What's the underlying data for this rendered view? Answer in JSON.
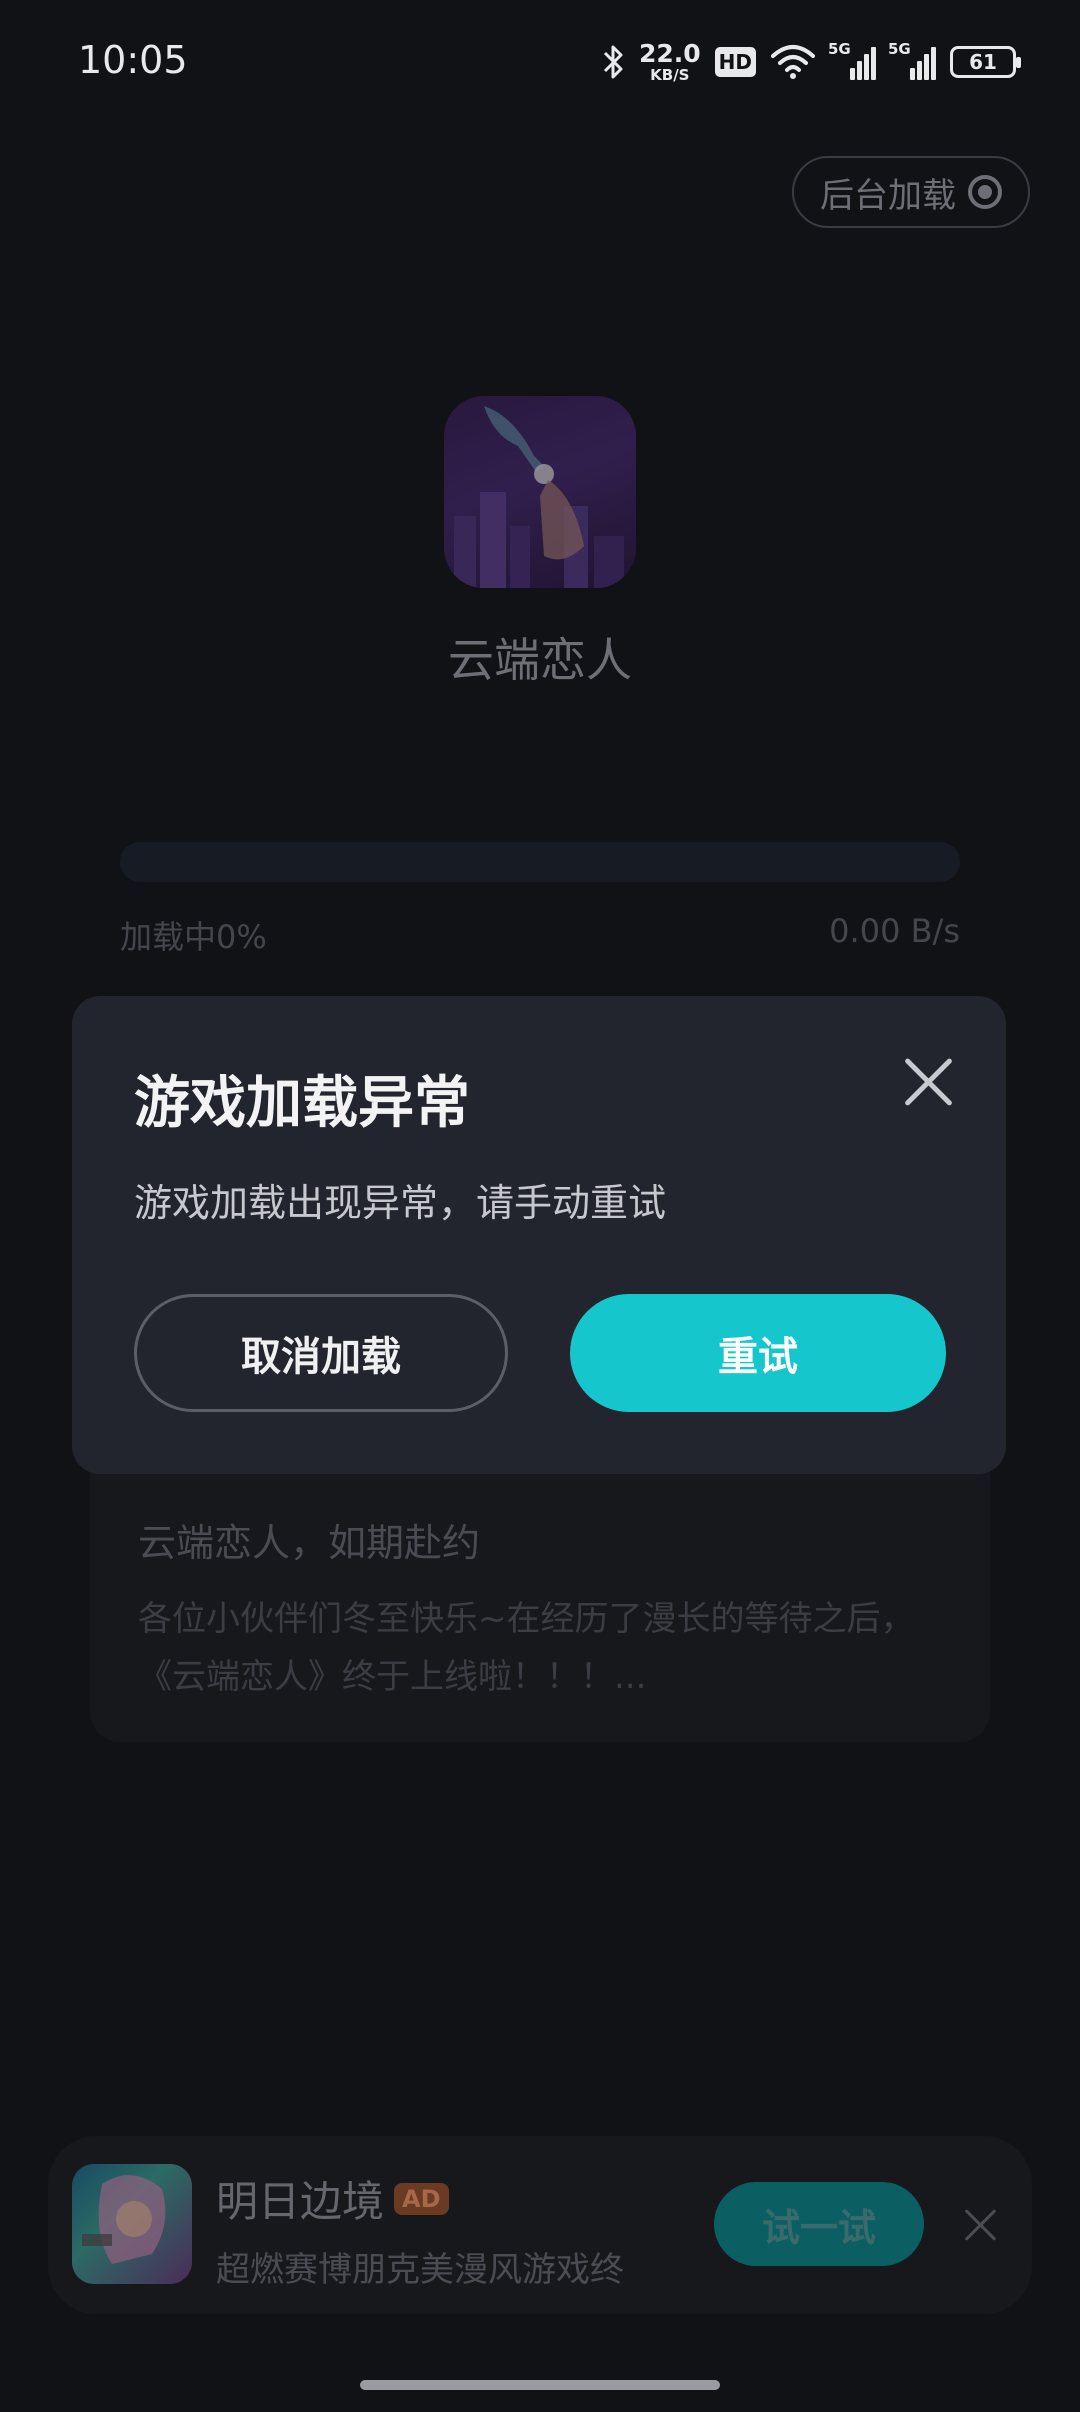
{
  "status_bar": {
    "time": "10:05",
    "net_speed_value": "22.0",
    "net_speed_unit": "KB/S",
    "hd_label": "HD",
    "signal_1_label": "5G",
    "signal_2_label": "5G",
    "battery_level": "61"
  },
  "header": {
    "background_load_label": "后台加载"
  },
  "app": {
    "name": "云端恋人"
  },
  "progress": {
    "label": "加载中0%",
    "percent": 0,
    "speed": "0.00 B/s"
  },
  "news": {
    "title": "云端恋人，如期赴约",
    "body": "各位小伙伴们冬至快乐~在经历了漫长的等待之后，《云端恋人》终于上线啦！！！..."
  },
  "dialog": {
    "title": "游戏加载异常",
    "message": "游戏加载出现异常，请手动重试",
    "cancel_label": "取消加载",
    "retry_label": "重试"
  },
  "ad": {
    "title": "明日边境",
    "badge": "AD",
    "description": "超燃赛博朋克美漫风游戏终",
    "try_label": "试一试"
  },
  "colors": {
    "accent": "#15c6cd",
    "background": "#111216",
    "dialog_bg": "#23252e"
  }
}
